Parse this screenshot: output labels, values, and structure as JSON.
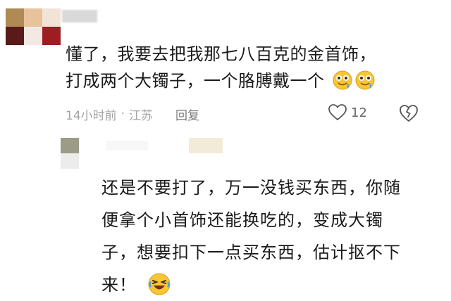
{
  "comment": {
    "lines": [
      "懂了，我要去把我那七八百克的金首饰，",
      "打成两个大镯子，一个胳膊戴一个"
    ],
    "emojis": [
      "drooling-face-icon",
      "drooling-face-icon"
    ],
    "time": "14小时前",
    "location": "江苏",
    "separator": "·",
    "reply_label": "回复",
    "like_count": "12"
  },
  "reply": {
    "lines": [
      "还是不要打了，万一没钱买东西，你随",
      "便拿个小首饰还能换吃的，变成大镯",
      "子，想要扣下一点买东西，估计抠不下",
      "来！"
    ],
    "emoji": "laughing-face-icon"
  },
  "colors": {
    "avatar_tiles": [
      "#b08a55",
      "#e7c29b",
      "#f2e3d7",
      "#5a1a1a",
      "#f4e8e2",
      "#9d1d22"
    ],
    "meta": "#a3a3a3",
    "text": "#1a1a1a"
  }
}
